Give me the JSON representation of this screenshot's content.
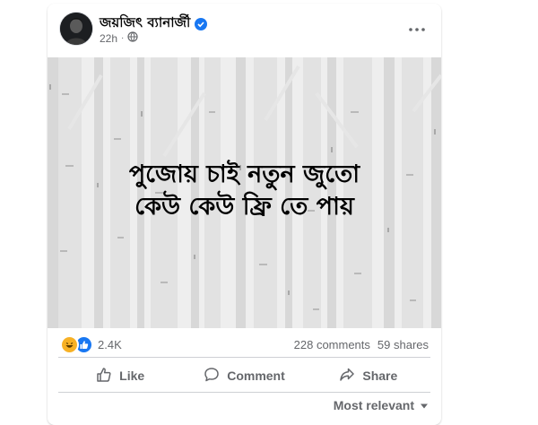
{
  "post": {
    "author": "জয়জিৎ ব্যানার্জী",
    "time": "22h",
    "image_text_line1": "পুজোয় চাই নতুন জুতো",
    "image_text_line2": "কেউ কেউ ফ্রি তে পায়",
    "reaction_count": "2.4K",
    "comments": "228 comments",
    "shares": "59 shares"
  },
  "actions": {
    "like": "Like",
    "comment": "Comment",
    "share": "Share"
  },
  "sort": {
    "label": "Most relevant"
  },
  "icons": {
    "privacy": "globe-icon",
    "verified": "verified-badge-icon",
    "menu": "more-options-icon"
  },
  "colors": {
    "accent": "#1877f2",
    "haha": "#f7b125",
    "secondary_text": "#65676b"
  }
}
